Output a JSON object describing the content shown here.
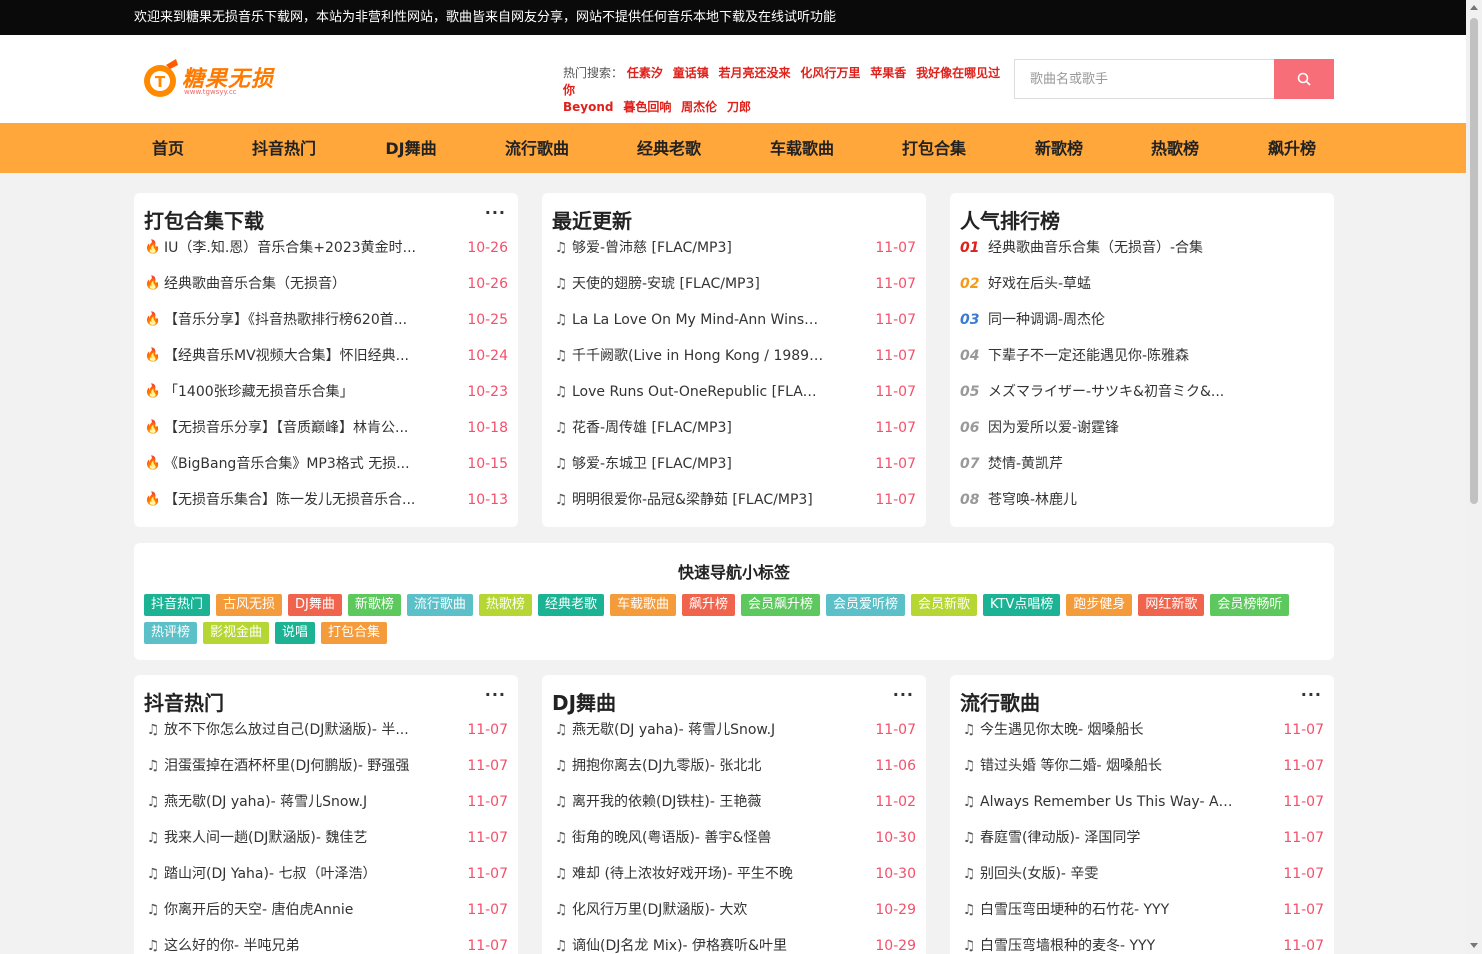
{
  "topbar": {
    "notice": "欢迎来到糖果无损音乐下载网，本站为非营利性网站，歌曲皆来自网友分享，网站不提供任何音乐本地下载及在线试听功能"
  },
  "logo": {
    "text": "糖果无损",
    "url": "www.tgwsyy.cc",
    "icon": "music-note-logo-icon"
  },
  "hot_search": {
    "label": "热门搜索：",
    "links": [
      "任素汐",
      "童话镇",
      "若月亮还没来",
      "化风行万里",
      "苹果香",
      "我好像在哪见过你",
      "Beyond",
      "暮色回响",
      "周杰伦",
      "刀郎"
    ]
  },
  "search": {
    "placeholder": "歌曲名或歌手",
    "icon": "search-icon",
    "button_color": "#f76d78"
  },
  "nav": [
    "首页",
    "抖音热门",
    "DJ舞曲",
    "流行歌曲",
    "经典老歌",
    "车载歌曲",
    "打包合集",
    "新歌榜",
    "热歌榜",
    "飙升榜"
  ],
  "colors": {
    "nav": "#ffa73a",
    "date": "#f4506a",
    "rank1": "#e0201a",
    "rank2": "#f49b1c",
    "rank3": "#3a7bd5",
    "rank_other": "#999999"
  },
  "sections_top": [
    {
      "title": "打包合集下载",
      "more": "···",
      "icon": "fire-icon",
      "items": [
        {
          "title": "IU（李.知.恩）音乐合集+2023黄金时...",
          "date": "10-26"
        },
        {
          "title": "经典歌曲音乐合集（无损音）",
          "date": "10-26"
        },
        {
          "title": "【音乐分享】《抖音热歌排行榜620首...",
          "date": "10-25"
        },
        {
          "title": "【经典音乐MV视频大合集】怀旧经典...",
          "date": "10-24"
        },
        {
          "title": "「1400张珍藏无损音乐合集」",
          "date": "10-23"
        },
        {
          "title": "【无损音乐分享】【音质巅峰】林肯公...",
          "date": "10-18"
        },
        {
          "title": "《BigBang音乐合集》MP3格式 无损...",
          "date": "10-15"
        },
        {
          "title": "【无损音乐集合】陈一发儿无损音乐合...",
          "date": "10-13"
        }
      ]
    },
    {
      "title": "最近更新",
      "icon": "music-note-icon",
      "items": [
        {
          "title": "够爱-曾沛慈 [FLAC/MP3]",
          "date": "11-07"
        },
        {
          "title": "天使的翅膀-安琥 [FLAC/MP3]",
          "date": "11-07"
        },
        {
          "title": "La La Love On My Mind-Ann Winsb...",
          "date": "11-07"
        },
        {
          "title": "千千阙歌(Live in Hong Kong / 1989-...",
          "date": "11-07"
        },
        {
          "title": "Love Runs Out-OneRepublic [FLAC/...",
          "date": "11-07"
        },
        {
          "title": "花香-周传雄 [FLAC/MP3]",
          "date": "11-07"
        },
        {
          "title": "够爱-东城卫 [FLAC/MP3]",
          "date": "11-07"
        },
        {
          "title": "明明很爱你-品冠&梁静茹 [FLAC/MP3]",
          "date": "11-07"
        }
      ]
    },
    {
      "title": "人气排行榜",
      "items": [
        {
          "rank": "01",
          "title": "经典歌曲音乐合集（无损音）-合集"
        },
        {
          "rank": "02",
          "title": "好戏在后头-草蜢"
        },
        {
          "rank": "03",
          "title": "同一种调调-周杰伦"
        },
        {
          "rank": "04",
          "title": "下辈子不一定还能遇见你-陈雅森"
        },
        {
          "rank": "05",
          "title": "メズマライザー-サツキ&初音ミク&..."
        },
        {
          "rank": "06",
          "title": "因为爱所以爱-谢霆锋"
        },
        {
          "rank": "07",
          "title": "焚情-黄凯芹"
        },
        {
          "rank": "08",
          "title": "苍穹唤-林鹿儿"
        }
      ]
    }
  ],
  "tags": {
    "title": "快速导航小标签",
    "items": [
      {
        "label": "抖音热门",
        "color": "#1bb394"
      },
      {
        "label": "古风无损",
        "color": "#f49b3c"
      },
      {
        "label": "DJ舞曲",
        "color": "#f0644e"
      },
      {
        "label": "新歌榜",
        "color": "#5dc85d"
      },
      {
        "label": "流行歌曲",
        "color": "#5bc0c8"
      },
      {
        "label": "热歌榜",
        "color": "#b5d633"
      },
      {
        "label": "经典老歌",
        "color": "#1bb394"
      },
      {
        "label": "车载歌曲",
        "color": "#f49b3c"
      },
      {
        "label": "飙升榜",
        "color": "#f0644e"
      },
      {
        "label": "会员飙升榜",
        "color": "#5dc85d"
      },
      {
        "label": "会员爱听榜",
        "color": "#5bc0c8"
      },
      {
        "label": "会员新歌",
        "color": "#b5d633"
      },
      {
        "label": "KTV点唱榜",
        "color": "#1bb394"
      },
      {
        "label": "跑步健身",
        "color": "#f49b3c"
      },
      {
        "label": "网红新歌",
        "color": "#f0644e"
      },
      {
        "label": "会员榜畅听",
        "color": "#5dc85d"
      },
      {
        "label": "热评榜",
        "color": "#5bc0c8"
      },
      {
        "label": "影视金曲",
        "color": "#b5d633"
      },
      {
        "label": "说唱",
        "color": "#1bb394"
      },
      {
        "label": "打包合集",
        "color": "#f49b3c"
      }
    ]
  },
  "sections_bottom": [
    {
      "title": "抖音热门",
      "more": "···",
      "items": [
        {
          "title": "放不下你怎么放过自己(DJ默涵版)- 半...",
          "date": "11-07"
        },
        {
          "title": "泪蛋蛋掉在酒杯杯里(DJ何鹏版)- 野强强",
          "date": "11-07"
        },
        {
          "title": "燕无歇(DJ yaha)- 蒋雪儿Snow.J",
          "date": "11-07"
        },
        {
          "title": "我来人间一趟(DJ默涵版)- 魏佳艺",
          "date": "11-07"
        },
        {
          "title": "踏山河(DJ Yaha)- 七叔（叶泽浩）",
          "date": "11-07"
        },
        {
          "title": "你离开后的天空- 唐伯虎Annie",
          "date": "11-07"
        },
        {
          "title": "这么好的你- 半吨兄弟",
          "date": "11-07"
        }
      ]
    },
    {
      "title": "DJ舞曲",
      "more": "···",
      "items": [
        {
          "title": "燕无歇(DJ yaha)- 蒋雪儿Snow.J",
          "date": "11-07"
        },
        {
          "title": "拥抱你离去(DJ九零版)- 张北北",
          "date": "11-06"
        },
        {
          "title": "离开我的依赖(DJ铁柱)- 王艳薇",
          "date": "11-02"
        },
        {
          "title": "街角的晚风(粤语版)- 善宇&怪兽",
          "date": "10-30"
        },
        {
          "title": "难却 (待上浓妆好戏开场)- 平生不晚",
          "date": "10-30"
        },
        {
          "title": "化风行万里(DJ默涵版)- 大欢",
          "date": "10-29"
        },
        {
          "title": "谪仙(DJ名龙 Mix)- 伊格赛听&叶里",
          "date": "10-29"
        }
      ]
    },
    {
      "title": "流行歌曲",
      "more": "···",
      "items": [
        {
          "title": "今生遇见你太晚- 烟嗓船长",
          "date": "11-07"
        },
        {
          "title": "错过头婚 等你二婚- 烟嗓船长",
          "date": "11-07"
        },
        {
          "title": "Always Remember Us This Way- Asp...",
          "date": "11-07"
        },
        {
          "title": "春庭雪(律动版)- 泽国同学",
          "date": "11-07"
        },
        {
          "title": "别回头(女版)- 辛雯",
          "date": "11-07"
        },
        {
          "title": "白雪压弯田埂种的石竹花- YYY",
          "date": "11-07"
        },
        {
          "title": "白雪压弯墙根种的麦冬- YYY",
          "date": "11-07"
        }
      ]
    }
  ]
}
